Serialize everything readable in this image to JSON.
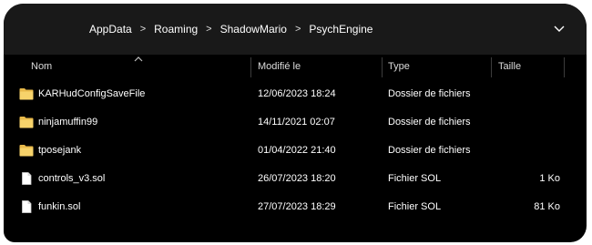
{
  "breadcrumb": [
    "AppData",
    "Roaming",
    "ShadowMario",
    "PsychEngine"
  ],
  "breadcrumb_separator": ">",
  "columns": {
    "name": "Nom",
    "date": "Modifié le",
    "type": "Type",
    "size": "Taille"
  },
  "files": [
    {
      "name": "KARHudConfigSaveFile",
      "date": "12/06/2023 18:24",
      "type": "Dossier de fichiers",
      "size": "",
      "icon": "folder-icon"
    },
    {
      "name": "ninjamuffin99",
      "date": "14/11/2021 02:07",
      "type": "Dossier de fichiers",
      "size": "",
      "icon": "folder-icon"
    },
    {
      "name": "tposejank",
      "date": "01/04/2022 21:40",
      "type": "Dossier de fichiers",
      "size": "",
      "icon": "folder-icon"
    },
    {
      "name": "controls_v3.sol",
      "date": "26/07/2023 18:20",
      "type": "Fichier SOL",
      "size": "1 Ko",
      "icon": "file-icon"
    },
    {
      "name": "funkin.sol",
      "date": "27/07/2023 18:29",
      "type": "Fichier SOL",
      "size": "81 Ko",
      "icon": "file-icon"
    }
  ],
  "colors": {
    "background": "#000000",
    "address_bar": "#191919",
    "folder": "#f2c94c",
    "text": "#ffffff"
  }
}
